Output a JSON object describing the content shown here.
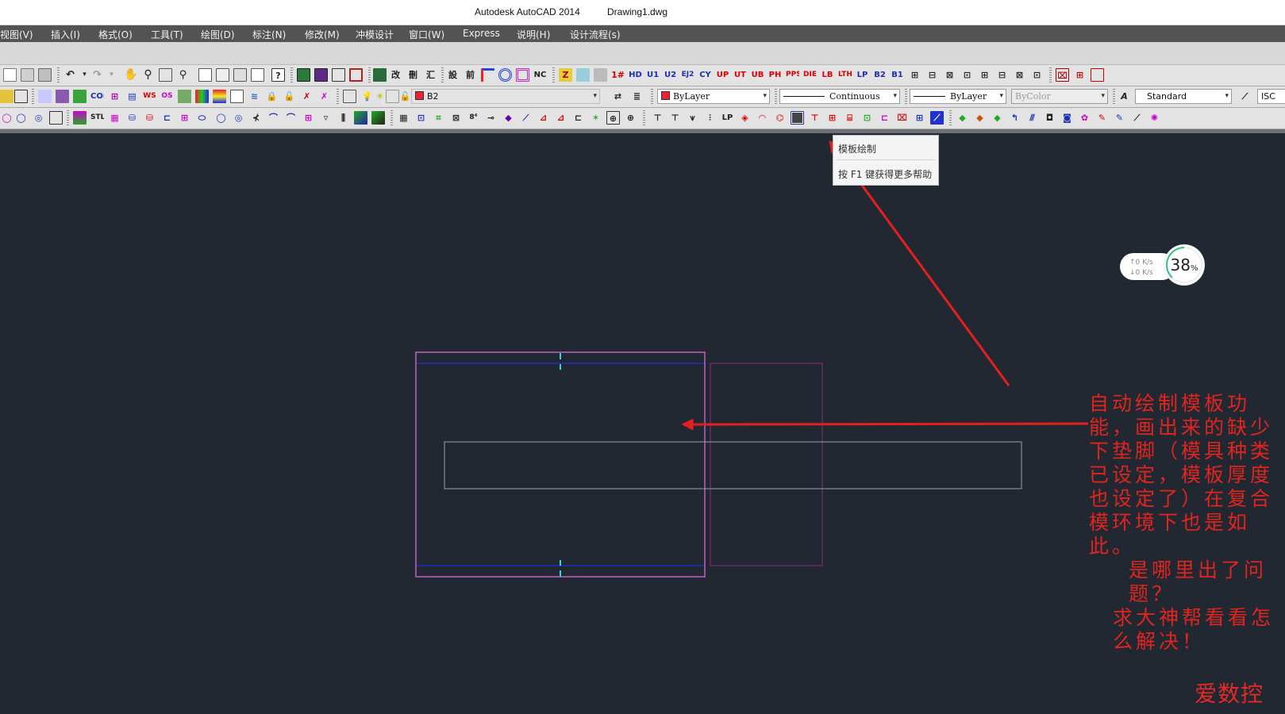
{
  "window": {
    "app_title": "Autodesk AutoCAD 2014",
    "file_name": "Drawing1.dwg"
  },
  "menu": [
    "视图(V)",
    "插入(I)",
    "格式(O)",
    "工具(T)",
    "绘图(D)",
    "标注(N)",
    "修改(M)",
    "冲模设计",
    "窗口(W)",
    "Express",
    "说明(H)",
    "设计流程(s)"
  ],
  "toolbar_row1_glyphs": [
    "改",
    "刪",
    "汇",
    "設",
    "前",
    "NC",
    "HD",
    "U1",
    "U2",
    "EJ2",
    "CY",
    "UP",
    "UT",
    "UB",
    "PH",
    "PPS",
    "DIE",
    "LB",
    "LTH",
    "LP",
    "B2",
    "B1"
  ],
  "properties": {
    "layer": "B2",
    "color": "ByLayer",
    "linetype": "Continuous",
    "lineweight": "ByLayer",
    "plotstyle": "ByColor",
    "text_style": "Standard",
    "dim_style_partial": "ISC"
  },
  "toolbar_row3_glyphs": [
    "STL",
    "LP"
  ],
  "tooltip": {
    "title": "模板绘制",
    "help": "按 F1 键获得更多帮助"
  },
  "network_widget": {
    "up": "↑0  K/s",
    "down": "↓0  K/s",
    "percent": "38",
    "percent_unit": "%"
  },
  "annotation": {
    "lines": [
      "自动绘制模板功能，画出来的缺少下垫脚（模具种类已设定，模板厚度也设定了）在复合模环境下也是如此。",
      "是哪里出了问题？",
      "求大神帮看看怎么解决！"
    ],
    "color": "#e0241e"
  },
  "watermark": "爱数控",
  "colors": {
    "canvas_bg": "#222832",
    "rect_magenta": "#d86ad8",
    "rect_dark_magenta": "#8e2a78",
    "line_blue": "#1f2fd8",
    "tick_cyan": "#2fd6e6",
    "rect_gray": "#9a9ea6",
    "arrow_red": "#e41f1f"
  }
}
